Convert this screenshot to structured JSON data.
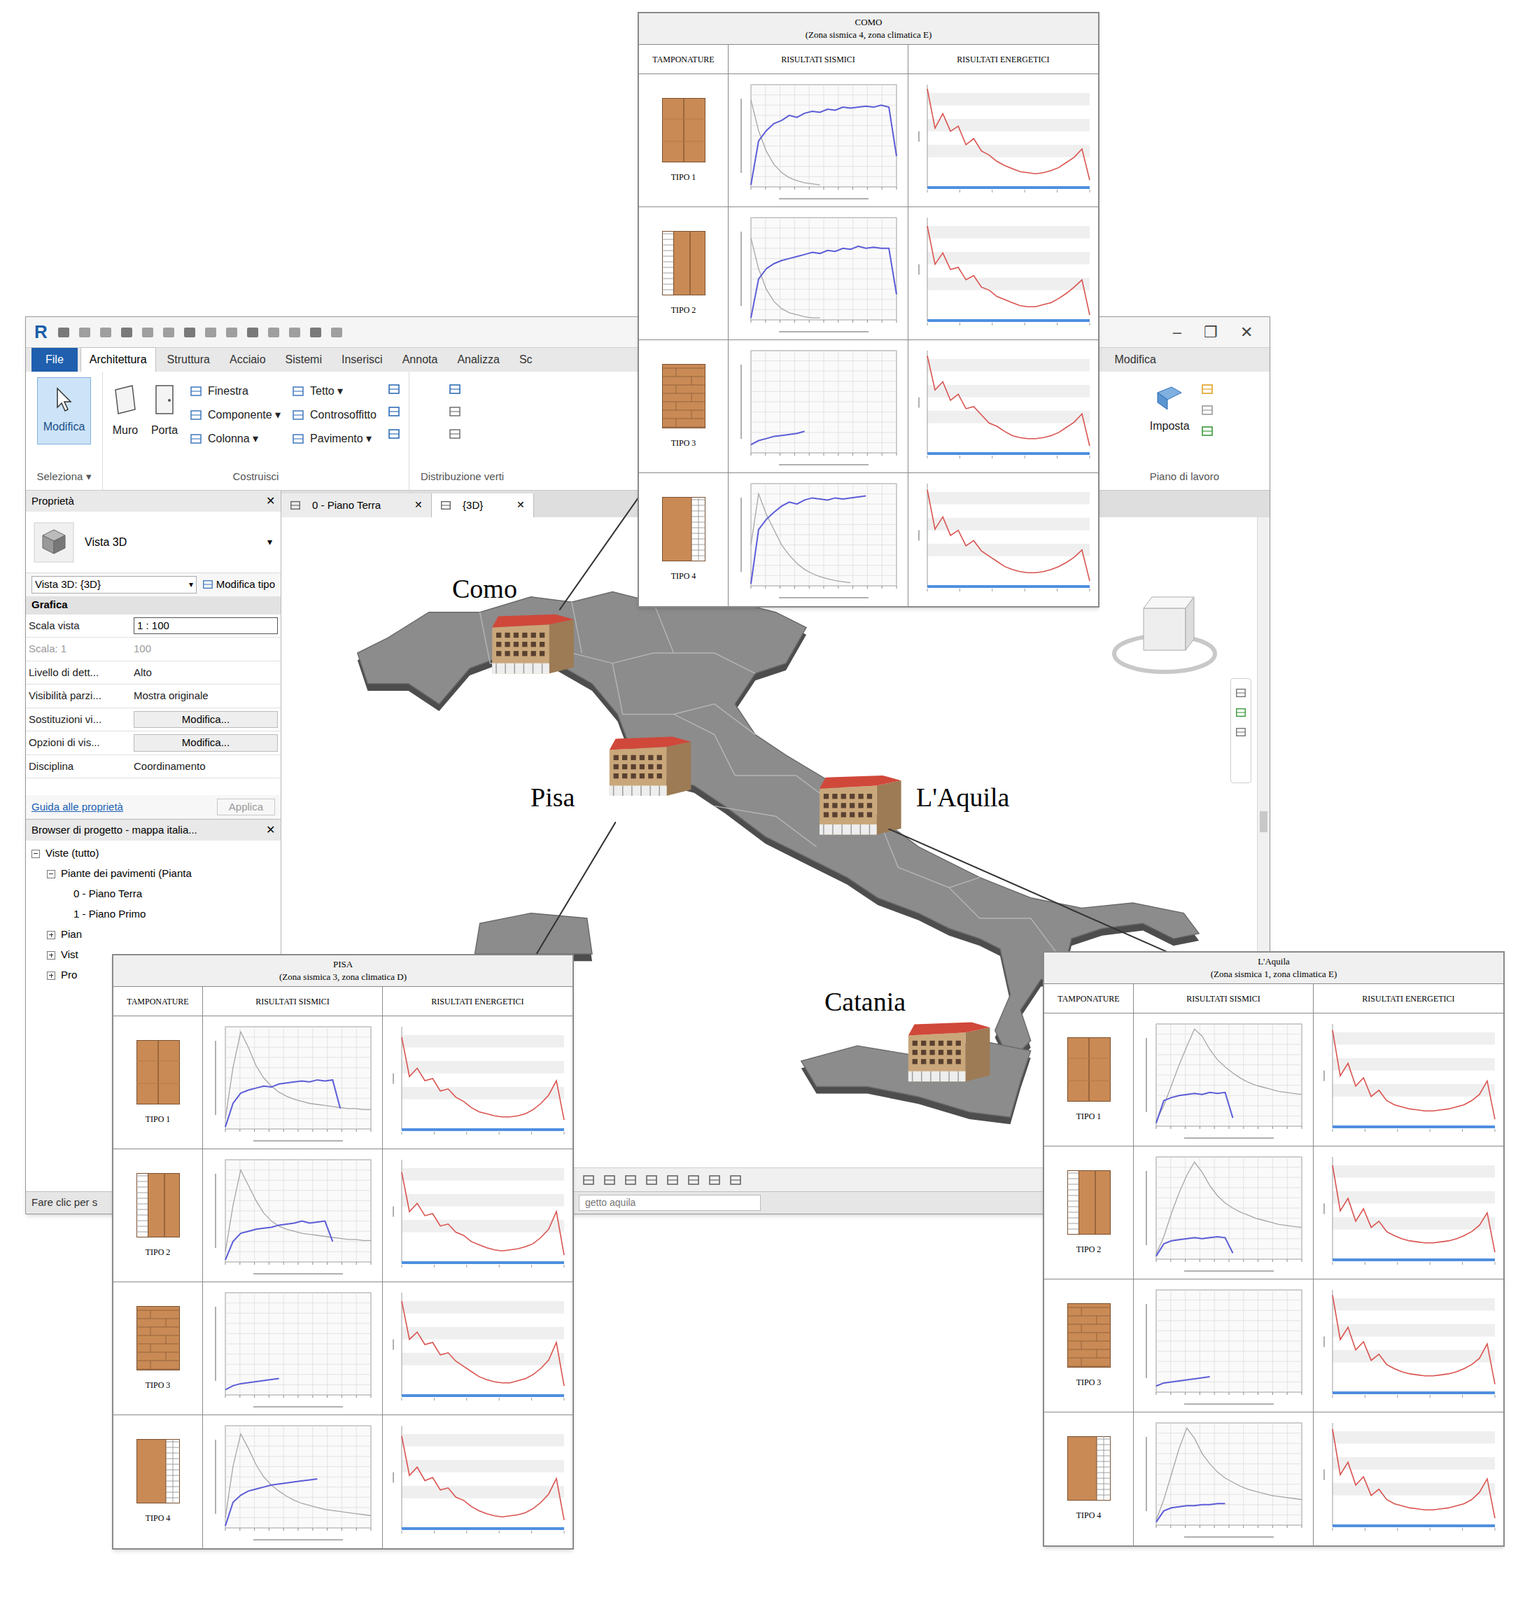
{
  "revit": {
    "logo": "R",
    "window_controls": [
      "–",
      "❐",
      "✕"
    ],
    "file_tab": "File",
    "tabs": [
      {
        "label": "Architettura",
        "selected": true
      },
      {
        "label": "Struttura",
        "selected": false
      },
      {
        "label": "Acciaio",
        "selected": false
      },
      {
        "label": "Sistemi",
        "selected": false
      },
      {
        "label": "Inserisci",
        "selected": false
      },
      {
        "label": "Annota",
        "selected": false
      },
      {
        "label": "Analizza",
        "selected": false
      },
      {
        "label": "Sc",
        "selected": false
      }
    ],
    "tabs_right": [
      {
        "label": "Modifica",
        "selected": false
      }
    ],
    "ribbon": {
      "select": {
        "tool": "Modifica",
        "selected": true,
        "label": "Seleziona ▾"
      },
      "build": {
        "label": "Costruisci",
        "large_tools": [
          "Muro",
          "Porta"
        ],
        "small_tools": [
          [
            "Finestra",
            "Componente ▾",
            "Colonna ▾"
          ],
          [
            "Tetto ▾",
            "Controsoffitto",
            "Pavimento ▾"
          ]
        ]
      },
      "circulation": {
        "label": "Distribuzione verti"
      },
      "workplane": {
        "tool": "Imposta",
        "label": "Piano di lavoro"
      }
    },
    "properties": {
      "title": "Proprietà",
      "close": "✕",
      "type_name": "Vista 3D",
      "type_arrow": "▾",
      "selector": "Vista 3D: {3D}",
      "selector_arrow": "▾",
      "edit_type": "Modifica tipo",
      "section": "Grafica",
      "rows": [
        {
          "name": "Scala vista",
          "value": "1 : 100",
          "kind": "input",
          "disabled": false
        },
        {
          "name": "Scala: 1",
          "value": "100",
          "kind": "text",
          "disabled": true
        },
        {
          "name": "Livello di dett...",
          "value": "Alto",
          "kind": "text",
          "disabled": false
        },
        {
          "name": "Visibilità parzi...",
          "value": "Mostra originale",
          "kind": "text",
          "disabled": false
        },
        {
          "name": "Sostituzioni vi...",
          "value": "Modifica...",
          "kind": "button",
          "disabled": false
        },
        {
          "name": "Opzioni di vis...",
          "value": "Modifica...",
          "kind": "button",
          "disabled": false
        },
        {
          "name": "Disciplina",
          "value": "Coordinamento",
          "kind": "text",
          "disabled": false
        }
      ],
      "help_link": "Guida alle proprietà",
      "apply": {
        "label": "Applica",
        "disabled": true
      }
    },
    "browser": {
      "title": "Browser di progetto - mappa italia...",
      "close": "✕",
      "items": [
        {
          "label": "Viste (tutto)",
          "level": 0,
          "expandable": true,
          "expanded": true
        },
        {
          "label": "Piante dei pavimenti (Pianta",
          "level": 1,
          "expandable": true,
          "expanded": true
        },
        {
          "label": "0 - Piano Terra",
          "level": 2,
          "expandable": false,
          "expanded": false
        },
        {
          "label": "1 - Piano Primo",
          "level": 2,
          "expandable": false,
          "expanded": false
        },
        {
          "label": "Pian",
          "level": 1,
          "expandable": true,
          "expanded": false
        },
        {
          "label": "Vist",
          "level": 1,
          "expandable": true,
          "expanded": false
        },
        {
          "label": "Pro",
          "level": 1,
          "expandable": true,
          "expanded": false
        }
      ]
    },
    "view_tabs": [
      {
        "label": "0 - Piano Terra",
        "selected": false,
        "close": "✕"
      },
      {
        "label": "{3D}",
        "selected": true,
        "close": "✕"
      }
    ],
    "status": {
      "message": "Fare clic per s",
      "field": "getto aquila"
    }
  },
  "map": {
    "cities": [
      {
        "name": "Como"
      },
      {
        "name": "Pisa"
      },
      {
        "name": "L'Aquila"
      },
      {
        "name": "Catania"
      }
    ]
  },
  "tables": [
    {
      "city": "COMO",
      "subtitle": "(Zona sismica 4, zona climatica E)",
      "columns": [
        "TAMPONATURE",
        "RISULTATI SISMICI",
        "RISULTATI ENERGETICI"
      ],
      "rows": [
        {
          "label": "TIPO 1",
          "kind": "double",
          "capacity": [
            2,
            45,
            55,
            62,
            65,
            70,
            68,
            72,
            74,
            73,
            76,
            75,
            78,
            77,
            78,
            79,
            78,
            80,
            78,
            30
          ],
          "demand": [
            85,
            55,
            35,
            22,
            14,
            9,
            6,
            4,
            3,
            2
          ],
          "energy": [
            96,
            58,
            72,
            55,
            60,
            42,
            48,
            36,
            32,
            26,
            22,
            19,
            16,
            15,
            14,
            15,
            17,
            20,
            25,
            30,
            38,
            8
          ]
        },
        {
          "label": "TIPO 2",
          "kind": "insulated-left",
          "capacity": [
            2,
            40,
            50,
            55,
            58,
            60,
            62,
            64,
            66,
            65,
            68,
            67,
            70,
            69,
            72,
            70,
            71,
            70,
            70,
            25
          ],
          "demand": [
            80,
            50,
            30,
            18,
            11,
            7,
            5,
            3,
            2,
            2
          ],
          "energy": [
            92,
            55,
            66,
            50,
            52,
            40,
            44,
            33,
            30,
            24,
            21,
            18,
            15,
            14,
            14,
            16,
            18,
            22,
            27,
            33,
            40,
            6
          ]
        },
        {
          "label": "TIPO 3",
          "kind": "brick",
          "capacity": [
            8,
            12,
            14,
            16,
            17,
            18,
            19,
            21
          ],
          "demand": [],
          "energy": [
            95,
            62,
            70,
            52,
            58,
            44,
            46,
            38,
            30,
            27,
            22,
            18,
            16,
            15,
            15,
            16,
            18,
            21,
            26,
            31,
            39,
            8
          ]
        },
        {
          "label": "TIPO 4",
          "kind": "insulated-right",
          "capacity": [
            2,
            55,
            65,
            72,
            78,
            82,
            80,
            84,
            86,
            85,
            84,
            86,
            85,
            86,
            87,
            88
          ],
          "demand": [
            40,
            90,
            70,
            55,
            40,
            30,
            22,
            16,
            12,
            9,
            7,
            5,
            4,
            3
          ],
          "energy": [
            94,
            56,
            68,
            50,
            55,
            40,
            45,
            35,
            30,
            25,
            20,
            17,
            15,
            14,
            14,
            15,
            17,
            20,
            24,
            29,
            36,
            6
          ]
        }
      ]
    },
    {
      "city": "PISA",
      "subtitle": "(Zona sismica 3, zona climatica D)",
      "columns": [
        "TAMPONATURE",
        "RISULTATI SISMICI",
        "RISULTATI ENERGETICI"
      ],
      "rows": [
        {
          "label": "TIPO 1",
          "kind": "double",
          "capacity": [
            2,
            25,
            35,
            38,
            40,
            42,
            41,
            44,
            45,
            46,
            47,
            46,
            48,
            47,
            48,
            20
          ],
          "demand": [
            10,
            60,
            95,
            80,
            62,
            50,
            42,
            36,
            32,
            29,
            27,
            25,
            24,
            23,
            22,
            21,
            20,
            20,
            19,
            19
          ],
          "energy": [
            90,
            52,
            60,
            48,
            50,
            38,
            40,
            32,
            28,
            22,
            18,
            16,
            14,
            13,
            13,
            14,
            16,
            20,
            26,
            34,
            48,
            10
          ]
        },
        {
          "label": "TIPO 2",
          "kind": "insulated-left",
          "capacity": [
            2,
            20,
            28,
            30,
            32,
            33,
            34,
            36,
            37,
            38,
            40,
            38,
            39,
            40,
            20
          ],
          "demand": [
            10,
            55,
            90,
            75,
            60,
            48,
            40,
            35,
            32,
            30,
            28,
            27,
            26,
            25,
            24,
            23,
            22,
            22,
            21,
            21
          ],
          "energy": [
            88,
            50,
            58,
            46,
            48,
            36,
            38,
            30,
            27,
            21,
            18,
            15,
            13,
            12,
            13,
            14,
            16,
            19,
            25,
            33,
            50,
            8
          ]
        },
        {
          "label": "TIPO 3",
          "kind": "brick",
          "capacity": [
            5,
            9,
            11,
            12,
            13,
            14,
            15,
            16
          ],
          "demand": [],
          "energy": [
            92,
            55,
            62,
            50,
            52,
            40,
            42,
            34,
            29,
            24,
            19,
            16,
            14,
            13,
            13,
            15,
            17,
            21,
            27,
            35,
            52,
            10
          ]
        },
        {
          "label": "TIPO 4",
          "kind": "insulated-right",
          "capacity": [
            2,
            25,
            32,
            36,
            38,
            40,
            42,
            43,
            44,
            45,
            46,
            47,
            48
          ],
          "demand": [
            10,
            60,
            92,
            78,
            62,
            50,
            42,
            36,
            31,
            27,
            24,
            22,
            20,
            18,
            17,
            16,
            15,
            14,
            13,
            12
          ],
          "energy": [
            90,
            52,
            60,
            47,
            50,
            38,
            40,
            31,
            28,
            22,
            18,
            15,
            13,
            12,
            13,
            14,
            16,
            20,
            26,
            34,
            49,
            9
          ]
        }
      ]
    },
    {
      "city": "L'Aquila",
      "subtitle": "(Zona sismica 1, zona climatica E)",
      "columns": [
        "TAMPONATURE",
        "RISULTATI SISMICI",
        "RISULTATI ENERGETICI"
      ],
      "rows": [
        {
          "label": "TIPO 1",
          "kind": "double",
          "capacity": [
            3,
            25,
            28,
            30,
            31,
            32,
            31,
            33,
            32,
            33,
            8
          ],
          "demand": [
            5,
            20,
            40,
            60,
            78,
            95,
            88,
            75,
            65,
            58,
            52,
            47,
            43,
            40,
            38,
            36,
            34,
            33,
            32,
            31
          ],
          "energy": [
            94,
            50,
            62,
            40,
            48,
            30,
            36,
            26,
            22,
            20,
            18,
            17,
            16,
            16,
            17,
            18,
            20,
            22,
            26,
            32,
            45,
            8
          ]
        },
        {
          "label": "TIPO 2",
          "kind": "insulated-left",
          "capacity": [
            3,
            15,
            18,
            19,
            20,
            21,
            20,
            21,
            22,
            21,
            6
          ],
          "demand": [
            5,
            22,
            45,
            65,
            82,
            95,
            85,
            72,
            62,
            55,
            50,
            46,
            43,
            40,
            38,
            36,
            34,
            33,
            32,
            31
          ],
          "energy": [
            92,
            48,
            60,
            38,
            50,
            32,
            38,
            28,
            24,
            21,
            19,
            18,
            17,
            17,
            18,
            19,
            21,
            24,
            28,
            34,
            46,
            8
          ]
        },
        {
          "label": "TIPO 3",
          "kind": "brick",
          "capacity": [
            6,
            9,
            10,
            11,
            12,
            13,
            14,
            15
          ],
          "demand": [],
          "energy": [
            95,
            52,
            64,
            42,
            50,
            32,
            38,
            28,
            24,
            21,
            19,
            18,
            17,
            17,
            18,
            19,
            21,
            24,
            28,
            34,
            48,
            9
          ]
        },
        {
          "label": "TIPO 4",
          "kind": "insulated-right",
          "capacity": [
            3,
            14,
            17,
            18,
            19,
            19,
            20,
            20,
            21,
            21
          ],
          "demand": [
            5,
            25,
            50,
            75,
            95,
            85,
            70,
            60,
            52,
            46,
            42,
            38,
            35,
            33,
            31,
            29,
            28,
            27,
            26,
            25
          ],
          "energy": [
            94,
            50,
            62,
            40,
            48,
            30,
            36,
            26,
            22,
            20,
            18,
            17,
            16,
            16,
            17,
            18,
            20,
            22,
            26,
            33,
            46,
            8
          ]
        }
      ]
    }
  ]
}
